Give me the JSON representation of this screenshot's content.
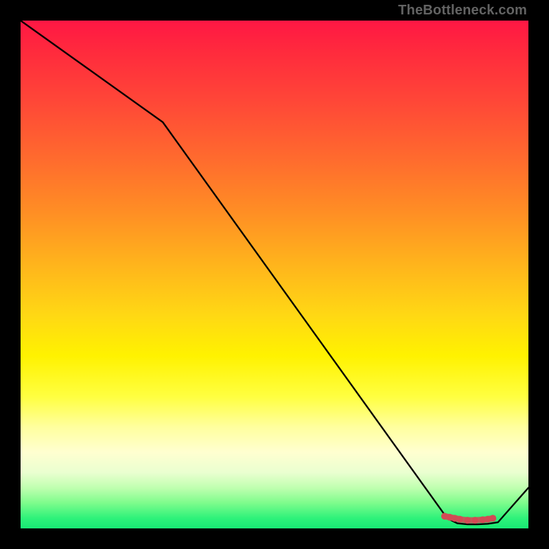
{
  "watermark": "TheBottleneck.com",
  "chart_data": {
    "type": "line",
    "title": "",
    "xlabel": "",
    "ylabel": "",
    "xlim": [
      0,
      100
    ],
    "ylim": [
      0,
      100
    ],
    "grid": false,
    "series": [
      {
        "name": "bottleneck-curve",
        "color": "#000000",
        "x": [
          0,
          28,
          84,
          86,
          88,
          90,
          92,
          94,
          100
        ],
        "values": [
          100,
          80,
          2,
          1,
          0.8,
          0.8,
          0.9,
          1.2,
          8
        ]
      }
    ],
    "markers": {
      "name": "optimal-band",
      "color": "#d24a55",
      "points": [
        {
          "x": 83.5,
          "y": 2.4
        },
        {
          "x": 84.5,
          "y": 2.2
        },
        {
          "x": 85.5,
          "y": 2.0
        },
        {
          "x": 86.5,
          "y": 1.8
        },
        {
          "x": 88.0,
          "y": 1.6
        },
        {
          "x": 89.5,
          "y": 1.6
        },
        {
          "x": 91.0,
          "y": 1.7
        },
        {
          "x": 92.0,
          "y": 1.8
        },
        {
          "x": 93.0,
          "y": 2.0
        }
      ]
    },
    "background": {
      "type": "vertical-gradient",
      "stops": [
        {
          "pos": 0.0,
          "color": "#ff1744"
        },
        {
          "pos": 0.5,
          "color": "#ffc107"
        },
        {
          "pos": 0.8,
          "color": "#ffff66"
        },
        {
          "pos": 1.0,
          "color": "#18e874"
        }
      ]
    }
  }
}
